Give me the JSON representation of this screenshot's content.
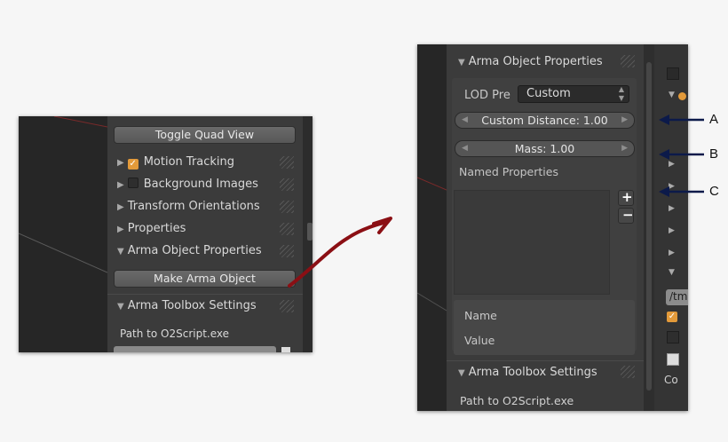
{
  "left_panel": {
    "toggle_quad_view": "Toggle Quad View",
    "rows": [
      {
        "label": "Motion Tracking",
        "checkbox": "checked"
      },
      {
        "label": "Background Images",
        "checkbox": "unchecked"
      },
      {
        "label": "Transform Orientations"
      },
      {
        "label": "Properties"
      },
      {
        "label": "Arma Object Properties",
        "expanded": true
      }
    ],
    "make_arma_object": "Make Arma Object",
    "toolbox_settings": "Arma Toolbox Settings",
    "path_label": "Path to O2Script.exe"
  },
  "right_panel": {
    "header": "Arma Object Properties",
    "lod_label": "LOD Pre",
    "lod_value": "Custom",
    "custom_distance": "Custom Distance: 1.00",
    "mass": "Mass: 1.00",
    "named_properties": "Named Properties",
    "add_symbol": "+",
    "remove_symbol": "−",
    "name_label": "Name",
    "value_label": "Value",
    "toolbox_settings": "Arma Toolbox Settings",
    "path_label": "Path to O2Script.exe",
    "right_fragment": "/tm",
    "right_fragment2": "Co"
  },
  "callouts": {
    "a": "A",
    "b": "B",
    "c": "C"
  },
  "colors": {
    "checkbox_checked": "#e39a3a",
    "arrow": "#8b0f14",
    "callout_arrow": "#0c1a4a"
  }
}
